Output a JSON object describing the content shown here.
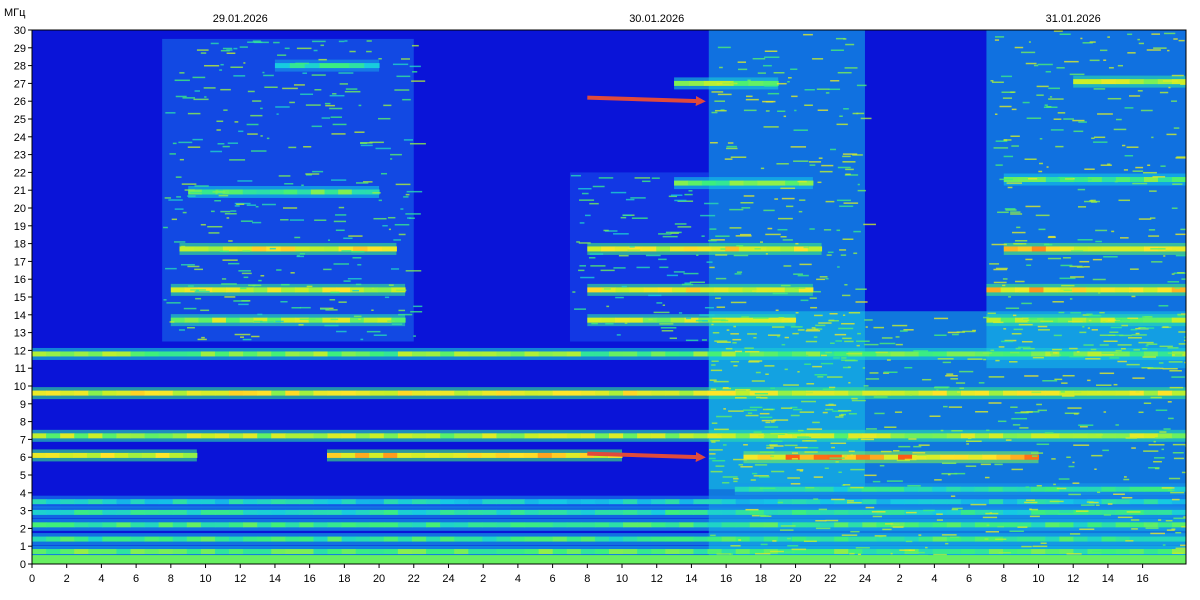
{
  "chart_data": {
    "type": "heatmap",
    "title": "",
    "ylabel": "МГц",
    "xlabel": "",
    "ylim": [
      0,
      30
    ],
    "y_ticks": [
      "0",
      "1",
      "2",
      "3",
      "4",
      "5",
      "6",
      "7",
      "8",
      "9",
      "10",
      "11",
      "12",
      "13",
      "14",
      "15",
      "16",
      "17",
      "18",
      "19",
      "20",
      "21",
      "22",
      "23",
      "24",
      "25",
      "26",
      "27",
      "28",
      "29",
      "30"
    ],
    "x_tick_labels": [
      "0",
      "2",
      "4",
      "6",
      "8",
      "10",
      "12",
      "14",
      "16",
      "18",
      "20",
      "22",
      "24",
      "2",
      "4",
      "6",
      "8",
      "10",
      "12",
      "14",
      "16",
      "18",
      "20",
      "22",
      "24",
      "2",
      "4",
      "6",
      "8",
      "10",
      "12",
      "14",
      "16"
    ],
    "x_range_hours": [
      0,
      66.5
    ],
    "dates": [
      {
        "label": "29.01.2026",
        "at_hour": 12
      },
      {
        "label": "30.01.2026",
        "at_hour": 36
      },
      {
        "label": "31.01.2026",
        "at_hour": 60
      }
    ],
    "colorscale": [
      "#0a14d8",
      "#1b4cf0",
      "#14c8e6",
      "#3ef07a",
      "#c8f028",
      "#ffe628",
      "#ff5a14"
    ],
    "background_color": "#0a14d8",
    "bands": [
      {
        "f": 0.7,
        "from": 0,
        "to": 66.5,
        "level": 0.55
      },
      {
        "f": 1.4,
        "from": 0,
        "to": 66.5,
        "level": 0.5
      },
      {
        "f": 2.2,
        "from": 0,
        "to": 66.5,
        "level": 0.5
      },
      {
        "f": 2.9,
        "from": 0,
        "to": 66.5,
        "level": 0.45
      },
      {
        "f": 3.5,
        "from": 0,
        "to": 66.5,
        "level": 0.4
      },
      {
        "f": 4.2,
        "from": 40.5,
        "to": 66.5,
        "level": 0.45
      },
      {
        "f": 6.1,
        "from": 0,
        "to": 9.5,
        "level": 0.8
      },
      {
        "f": 6.1,
        "from": 17,
        "to": 34,
        "level": 0.85
      },
      {
        "f": 6.0,
        "from": 41,
        "to": 58,
        "level": 0.95
      },
      {
        "f": 7.2,
        "from": 0,
        "to": 66.5,
        "level": 0.7
      },
      {
        "f": 9.6,
        "from": 0,
        "to": 66.5,
        "level": 0.78
      },
      {
        "f": 11.8,
        "from": 0,
        "to": 66.5,
        "level": 0.6
      },
      {
        "f": 13.7,
        "from": 8,
        "to": 21.5,
        "level": 0.7
      },
      {
        "f": 13.7,
        "from": 32,
        "to": 44,
        "level": 0.72
      },
      {
        "f": 13.7,
        "from": 55,
        "to": 66.5,
        "level": 0.7
      },
      {
        "f": 15.4,
        "from": 8,
        "to": 21.5,
        "level": 0.78
      },
      {
        "f": 15.4,
        "from": 32,
        "to": 45,
        "level": 0.8
      },
      {
        "f": 15.4,
        "from": 55,
        "to": 66.5,
        "level": 0.85
      },
      {
        "f": 17.7,
        "from": 8.5,
        "to": 21,
        "level": 0.8
      },
      {
        "f": 17.7,
        "from": 32,
        "to": 45.5,
        "level": 0.82
      },
      {
        "f": 17.7,
        "from": 56,
        "to": 66.5,
        "level": 0.88
      },
      {
        "f": 20.9,
        "from": 9,
        "to": 20,
        "level": 0.55
      },
      {
        "f": 21.4,
        "from": 37,
        "to": 45,
        "level": 0.55
      },
      {
        "f": 21.6,
        "from": 56,
        "to": 66.5,
        "level": 0.55
      },
      {
        "f": 27.0,
        "from": 37,
        "to": 43,
        "level": 0.6
      },
      {
        "f": 27.1,
        "from": 60,
        "to": 66.5,
        "level": 0.7
      },
      {
        "f": 28.0,
        "from": 14,
        "to": 20,
        "level": 0.45
      }
    ],
    "blobs": [
      {
        "h0": 39,
        "h1": 48,
        "f0": 4.2,
        "f1": 30,
        "level": 0.32
      },
      {
        "h0": 39,
        "h1": 66.5,
        "f0": 0,
        "f1": 14.2,
        "level": 0.34
      },
      {
        "h0": 55,
        "h1": 66.5,
        "f0": 11,
        "f1": 30,
        "level": 0.32
      },
      {
        "h0": 7.5,
        "h1": 22,
        "f0": 12.5,
        "f1": 29.5,
        "level": 0.22
      },
      {
        "h0": 31,
        "h1": 39,
        "f0": 12.5,
        "f1": 22,
        "level": 0.18
      }
    ],
    "annotations": [
      {
        "type": "arrow",
        "color": "#e04a3c",
        "from": {
          "hour": 32,
          "freq": 26.2
        },
        "to": {
          "hour": 38.6,
          "freq": 26.0
        }
      },
      {
        "type": "arrow",
        "color": "#e04a3c",
        "from": {
          "hour": 32,
          "freq": 6.2
        },
        "to": {
          "hour": 38.6,
          "freq": 6.0
        }
      }
    ]
  }
}
